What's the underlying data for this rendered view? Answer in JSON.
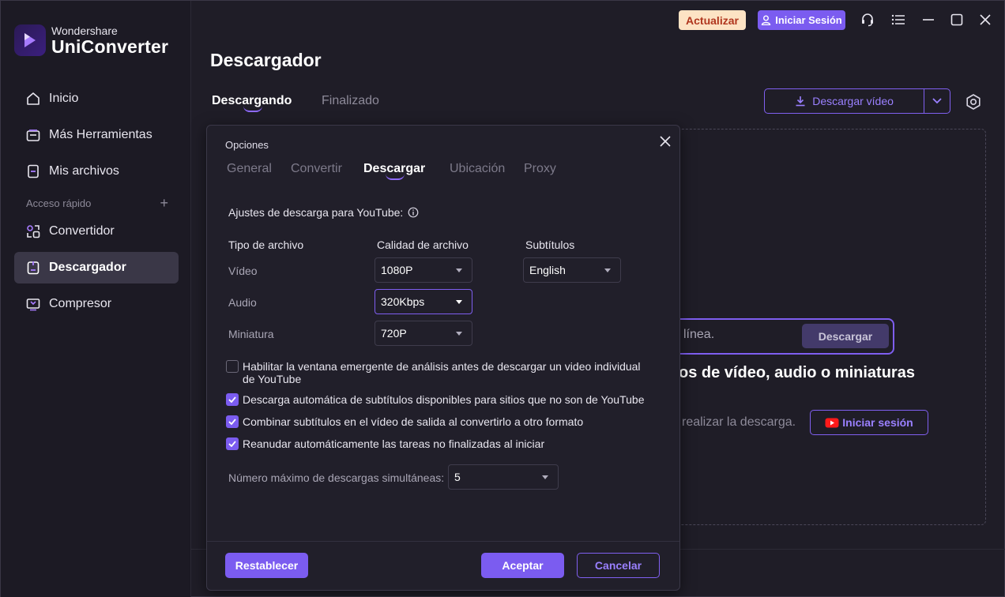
{
  "brand": {
    "company": "Wondershare",
    "product": "UniConverter"
  },
  "sidebar": {
    "items": [
      {
        "label": "Inicio",
        "icon": "home-icon"
      },
      {
        "label": "Más Herramientas",
        "icon": "toolbox-icon"
      },
      {
        "label": "Mis archivos",
        "icon": "files-icon"
      }
    ],
    "quick_access_label": "Acceso rápido",
    "quick_items": [
      {
        "label": "Convertidor",
        "icon": "converter-icon"
      },
      {
        "label": "Descargador",
        "icon": "downloader-icon",
        "active": true
      },
      {
        "label": "Compresor",
        "icon": "compressor-icon"
      }
    ]
  },
  "topbar": {
    "upgrade_label": "Actualizar",
    "login_label": "Iniciar Sesión",
    "icons": [
      "support-icon",
      "menu-icon",
      "minimize-icon",
      "maximize-icon",
      "close-icon"
    ]
  },
  "main": {
    "title": "Descargador",
    "tabs": [
      {
        "label": "Descargando",
        "active": true
      },
      {
        "label": "Finalizado",
        "active": false
      }
    ],
    "download_button_label": "Descargar vídeo",
    "url_placeholder_visible": "línea.",
    "download_label": "Descargar",
    "hint_title": "os de vídeo, audio o miniaturas",
    "hint_text": "realizar la descarga.",
    "yt_login_label": "Iniciar sesión"
  },
  "dialog": {
    "title": "Opciones",
    "tabs": [
      {
        "label": "General",
        "active": false
      },
      {
        "label": "Convertir",
        "active": false
      },
      {
        "label": "Descargar",
        "active": true
      },
      {
        "label": "Ubicación",
        "active": false
      },
      {
        "label": "Proxy",
        "active": false
      }
    ],
    "section_title": "Ajustes de descarga para YouTube:",
    "columns": {
      "type": "Tipo de archivo",
      "quality": "Calidad de archivo",
      "subtitles": "Subtítulos"
    },
    "rows": [
      {
        "label": "Vídeo",
        "quality": "1080P",
        "subtitle": "English"
      },
      {
        "label": "Audio",
        "quality": "320Kbps"
      },
      {
        "label": "Miniatura",
        "quality": "720P"
      }
    ],
    "checkboxes": [
      {
        "label": "Habilitar la ventana emergente de análisis antes de descargar un video individual de YouTube",
        "checked": false
      },
      {
        "label": "Descarga automática de subtítulos disponibles para sitios que no son de YouTube",
        "checked": true
      },
      {
        "label": "Combinar subtítulos en el vídeo de salida al convertirlo a otro formato",
        "checked": true
      },
      {
        "label": "Reanudar automáticamente las tareas no finalizadas al iniciar",
        "checked": true
      }
    ],
    "max_downloads_label": "Número máximo de descargas simultáneas:",
    "max_downloads_value": "5",
    "reset_label": "Restablecer",
    "ok_label": "Aceptar",
    "cancel_label": "Cancelar"
  },
  "colors": {
    "accent": "#7b5cf0",
    "background": "#1f1d27",
    "sidebar": "#1c1a24",
    "upgrade_bg": "#fde3c4",
    "upgrade_text": "#b0361e"
  }
}
